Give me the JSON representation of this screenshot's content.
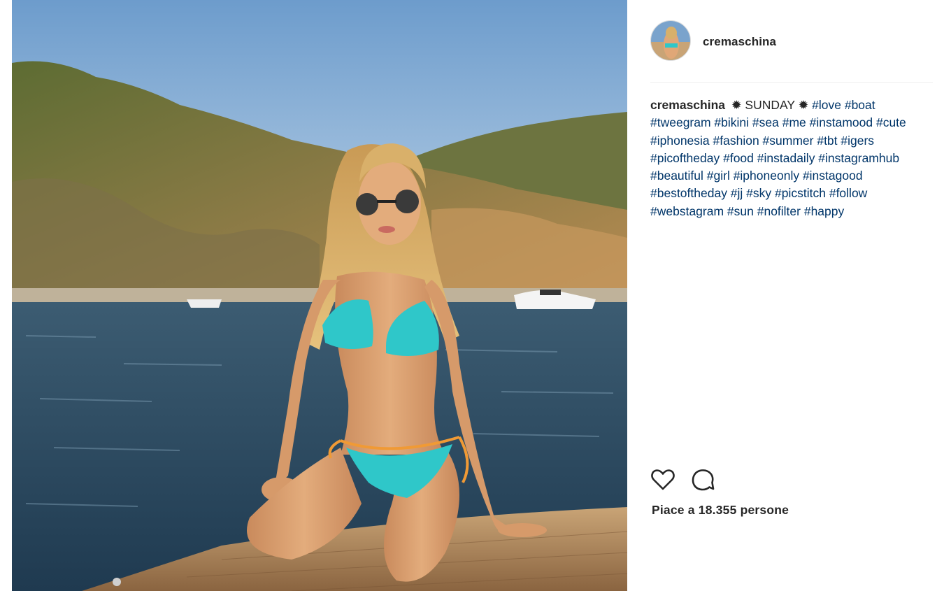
{
  "post": {
    "username": "cremaschina",
    "caption_user": "cremaschina",
    "caption_text": "✹ SUNDAY ✹",
    "hashtags": "#love #boat #tweegram #bikini #sea #me #instamood #cute #iphonesia #fashion #summer #tbt #igers #picoftheday #food #instadaily #instagramhub #beautiful #girl #iphoneonly #instagood #bestoftheday #jj #sky #picstitch #follow #webstagram #sun #nofilter #happy",
    "likes_text": "Piace a 18.355 persone"
  },
  "icons": {
    "like": "heart-icon",
    "comment": "comment-bubble-icon"
  },
  "colors": {
    "hashtag": "#003569",
    "text": "#262626",
    "divider": "#efefef"
  }
}
